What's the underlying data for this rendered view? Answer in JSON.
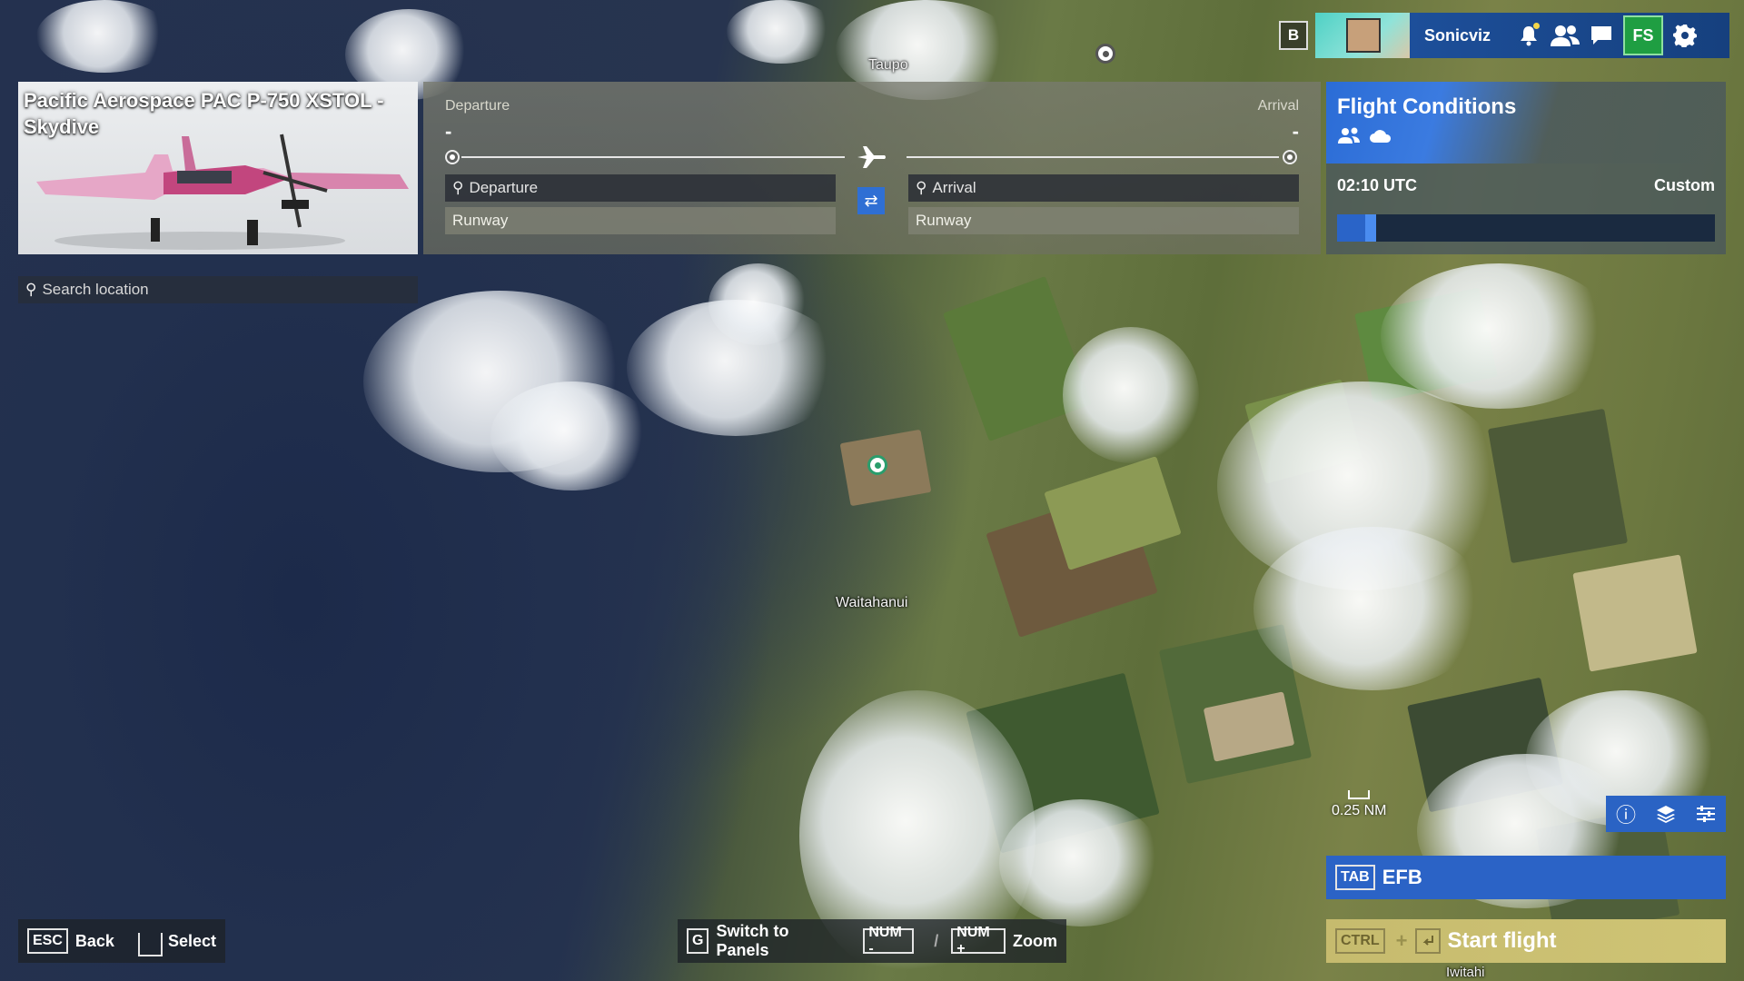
{
  "topbar": {
    "b_key": "B",
    "username": "Sonicviz",
    "fs_label": "FS"
  },
  "map": {
    "labels": {
      "taupo": "Taupo",
      "waitahanui": "Waitahanui",
      "iwitahi": "Iwitahi"
    },
    "scale": "0.25 NM"
  },
  "aircraft": {
    "title": "Pacific Aerospace PAC P-750 XSTOL - Skydive"
  },
  "search_location": {
    "placeholder": "Search location"
  },
  "flight_plan": {
    "departure_header": "Departure",
    "arrival_header": "Arrival",
    "departure_code": "-",
    "arrival_code": "-",
    "departure_search": "Departure",
    "arrival_search": "Arrival",
    "departure_runway": "Runway",
    "arrival_runway": "Runway"
  },
  "flight_conditions": {
    "title": "Flight Conditions",
    "time": "02:10 UTC",
    "mode": "Custom",
    "time_progress": 0.09
  },
  "efb": {
    "key": "TAB",
    "label": "EFB"
  },
  "start_flight": {
    "key": "CTRL",
    "plus": "+",
    "label": "Start flight"
  },
  "hints": {
    "esc_key": "ESC",
    "back": "Back",
    "select": "Select",
    "g_key": "G",
    "switch_panels": "Switch to Panels",
    "num_minus": "NUM -",
    "slash": "/",
    "num_plus": "NUM +",
    "zoom": "Zoom"
  },
  "colors": {
    "accent": "#2b63c6",
    "start": "#c9be70",
    "poi": "#2a9d6c"
  }
}
